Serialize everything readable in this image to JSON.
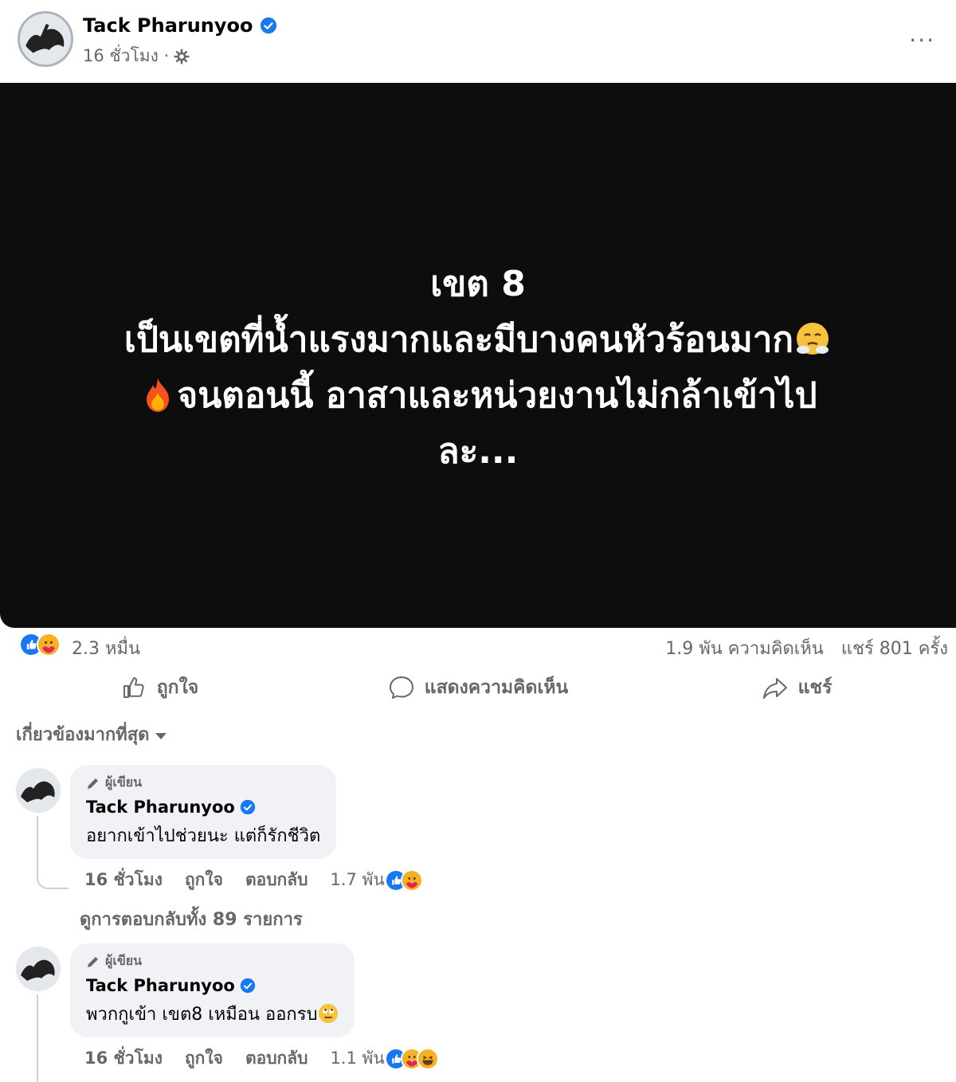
{
  "post": {
    "author": "Tack Pharunyoo",
    "time": "16 ชั่วโมง ·",
    "more": "···",
    "text_lines": [
      "เขต 8",
      "เป็นเขตที่น้ำแรงมากและมีบางคนหัวร้อนมาก",
      "จนตอนนี้ อาสาและหน่วยงานไม่กล้าเข้าไป",
      "ละ..."
    ],
    "emojis": [
      "steam-face-emoji",
      "fire-emoji"
    ],
    "background_color": "#0d0d0d"
  },
  "stats": {
    "reactions": "2.3 หมื่น",
    "comments": "1.9 พัน ความคิดเห็น",
    "shares": "แชร์ 801 ครั้ง"
  },
  "actions": {
    "like": "ถูกใจ",
    "comment": "แสดงความคิดเห็น",
    "share": "แชร์"
  },
  "sort_label": "เกี่ยวข้องมากที่สุด",
  "comments": [
    {
      "author_tag": "ผู้เขียน",
      "author": "Tack Pharunyoo",
      "text": "อยากเข้าไปช่วยนะ แต่ก็รักชีวิต",
      "time": "16 ชั่วโมง",
      "like": "ถูกใจ",
      "reply": "ตอบกลับ",
      "reaction_count": "1.7 พัน",
      "view_replies": "ดูการตอบกลับทั้ง 89 รายการ"
    },
    {
      "author_tag": "ผู้เขียน",
      "author": "Tack Pharunyoo",
      "text": "พวกกูเข้า เขต8 เหมือน ออกรบ",
      "time": "16 ชั่วโมง",
      "like": "ถูกใจ",
      "reply": "ตอบกลับ",
      "reaction_count": "1.1 พัน"
    }
  ],
  "colors": {
    "accent": "#1877f2",
    "muted": "#65676b",
    "bubble": "#f0f2f5"
  }
}
